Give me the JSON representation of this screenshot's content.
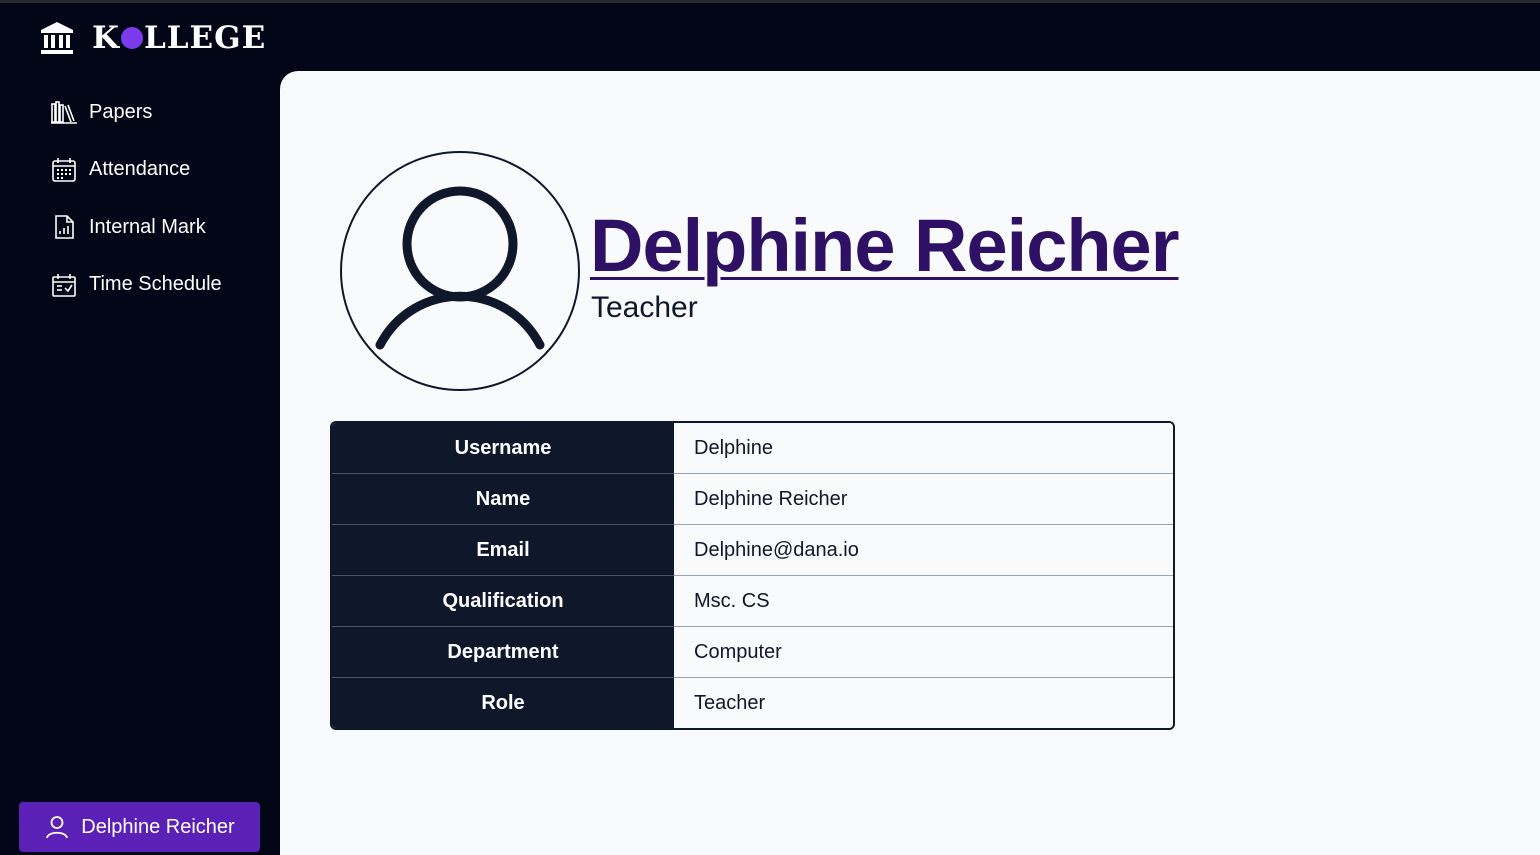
{
  "app": {
    "logo_text_before": "K",
    "logo_text_after": "LLEGE",
    "logo_icon": "institution-icon",
    "accent_color": "#7c3aed"
  },
  "sidebar": {
    "items": [
      {
        "label": "Papers",
        "icon": "books-icon"
      },
      {
        "label": "Attendance",
        "icon": "calendar-grid-icon"
      },
      {
        "label": "Internal Mark",
        "icon": "report-chart-icon"
      },
      {
        "label": "Time Schedule",
        "icon": "calendar-check-icon"
      }
    ],
    "user_button": {
      "label": "Delphine Reicher",
      "icon": "user-icon",
      "color": "#5b21b6"
    }
  },
  "profile": {
    "name": "Delphine Reicher",
    "role": "Teacher",
    "avatar_icon": "user-avatar-icon",
    "name_color": "#2e1065"
  },
  "details": [
    {
      "label": "Username",
      "value": "Delphine"
    },
    {
      "label": "Name",
      "value": "Delphine Reicher"
    },
    {
      "label": "Email",
      "value": "Delphine@dana.io"
    },
    {
      "label": "Qualification",
      "value": "Msc. CS"
    },
    {
      "label": "Department",
      "value": "Computer"
    },
    {
      "label": "Role",
      "value": "Teacher"
    }
  ]
}
